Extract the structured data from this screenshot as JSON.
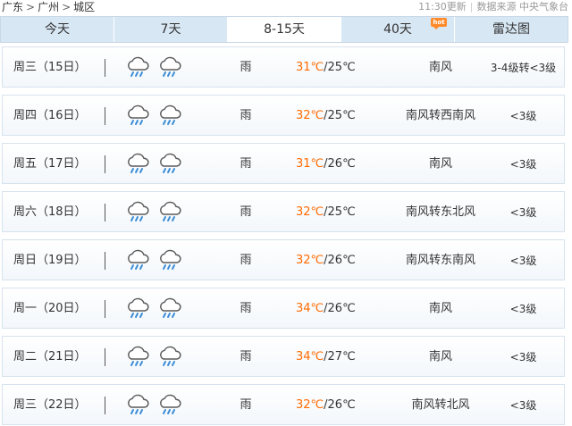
{
  "breadcrumb": {
    "province": "广东",
    "city": "广州",
    "district": "城区",
    "separator": ">"
  },
  "meta": {
    "update_time": "11:30更新",
    "divider": "|",
    "source": "数据来源 中央气象台"
  },
  "tabs": [
    {
      "label": "今天",
      "active": false,
      "badge": ""
    },
    {
      "label": "7天",
      "active": false,
      "badge": ""
    },
    {
      "label": "8-15天",
      "active": true,
      "badge": ""
    },
    {
      "label": "40天",
      "active": false,
      "badge": "hot"
    },
    {
      "label": "雷达图",
      "active": false,
      "badge": ""
    }
  ],
  "colors": {
    "high_temp": "#ff6a00",
    "tab_bg": "#d8e7f4",
    "hot_badge": "#ff8a2a"
  },
  "forecast": [
    {
      "day": "周三（15日）",
      "icons": [
        "rain-cloud-icon",
        "rain-cloud-icon"
      ],
      "condition": "雨",
      "high": "31℃",
      "low": "/25℃",
      "wind": "南风",
      "level": "3-4级转<3级"
    },
    {
      "day": "周四（16日）",
      "icons": [
        "rain-cloud-icon",
        "rain-cloud-icon"
      ],
      "condition": "雨",
      "high": "32℃",
      "low": "/25℃",
      "wind": "南风转西南风",
      "level": "<3级"
    },
    {
      "day": "周五（17日）",
      "icons": [
        "rain-cloud-icon",
        "rain-cloud-icon"
      ],
      "condition": "雨",
      "high": "31℃",
      "low": "/26℃",
      "wind": "南风",
      "level": "<3级"
    },
    {
      "day": "周六（18日）",
      "icons": [
        "rain-cloud-icon",
        "rain-cloud-icon"
      ],
      "condition": "雨",
      "high": "32℃",
      "low": "/25℃",
      "wind": "南风转东北风",
      "level": "<3级"
    },
    {
      "day": "周日（19日）",
      "icons": [
        "rain-cloud-icon",
        "rain-cloud-icon"
      ],
      "condition": "雨",
      "high": "32℃",
      "low": "/26℃",
      "wind": "南风转东南风",
      "level": "<3级"
    },
    {
      "day": "周一（20日）",
      "icons": [
        "rain-cloud-icon",
        "rain-cloud-icon"
      ],
      "condition": "雨",
      "high": "34℃",
      "low": "/26℃",
      "wind": "南风",
      "level": "<3级"
    },
    {
      "day": "周二（21日）",
      "icons": [
        "rain-cloud-icon",
        "rain-cloud-icon"
      ],
      "condition": "雨",
      "high": "34℃",
      "low": "/27℃",
      "wind": "南风",
      "level": "<3级"
    },
    {
      "day": "周三（22日）",
      "icons": [
        "rain-cloud-icon",
        "rain-cloud-icon"
      ],
      "condition": "雨",
      "high": "32℃",
      "low": "/26℃",
      "wind": "南风转北风",
      "level": "<3级"
    }
  ]
}
